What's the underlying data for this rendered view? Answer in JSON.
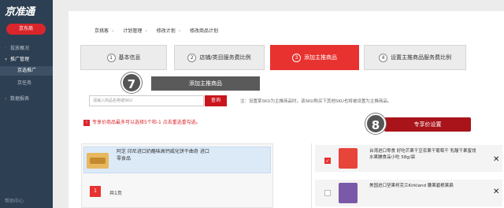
{
  "sidebar": {
    "logo": "京准通",
    "badge": "京东商",
    "items": [
      {
        "label": "投放概况"
      },
      {
        "label": "推广管理"
      },
      {
        "label": "京选推广"
      },
      {
        "label": "京任务"
      },
      {
        "label": "数据报表"
      }
    ],
    "help": "帮助中心"
  },
  "breadcrumb": [
    "京挑客",
    "计划管理",
    "修改计划",
    "修改商品计划"
  ],
  "steps": [
    {
      "num": "1",
      "label": "基本信息"
    },
    {
      "num": "2",
      "label": "店铺/类目服务费比例"
    },
    {
      "num": "3",
      "label": "添加主推商品"
    },
    {
      "num": "4",
      "label": "设置主推商品服务费比例"
    }
  ],
  "annotations": {
    "marker7": "7",
    "label7": "添加主推商品",
    "marker8": "8",
    "label8": "专享价设置"
  },
  "search": {
    "placeholder": "请输入商品名称或SKU",
    "button": "查询",
    "note": "注：设置某SKU为主推商品时，该SKU购买下其他SKU也将被设置为主推商品。"
  },
  "warning": "专享价商品最多可以选择5个和-1 点击重选重勾选。",
  "left_list": {
    "product_name": "阿芝 印尼进口奶酪味高钙威化饼干曲奇 进口零食品",
    "page": "1",
    "total": "共1页"
  },
  "right_list": [
    {
      "name": "台湾进口零食 好吃芒果干豆农果干葡萄干 乳酸干果蜜饯水果脯食品小吃 58g/袋",
      "checked": true
    },
    {
      "name": "美国进口坚果柯克兰Kirkland 腰果碧根果扁",
      "checked": false
    }
  ],
  "colors": {
    "sidebar_bg": "#2d3f52",
    "accent_red": "#e8322f",
    "dark_red": "#a8141a"
  }
}
